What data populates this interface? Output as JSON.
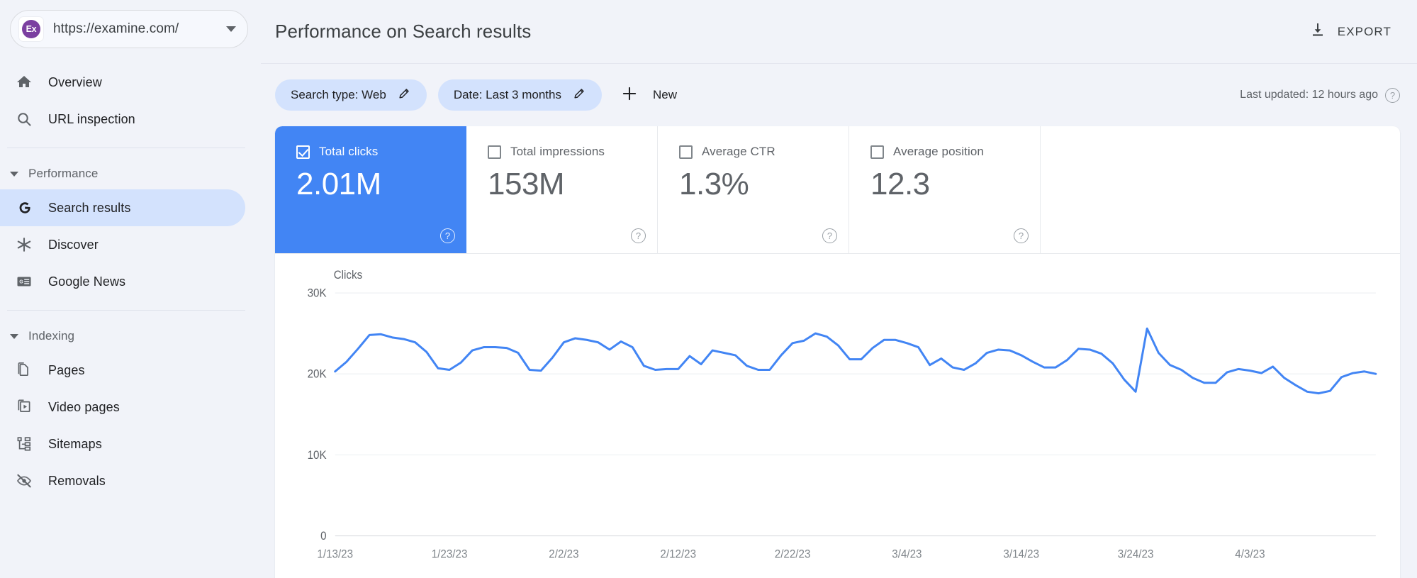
{
  "sidebar": {
    "property": {
      "favicon_text": "Ex",
      "favicon_color": "#7b3fa0",
      "url": "https://examine.com/",
      "dropdown_icon": "chevron-down-icon"
    },
    "top_items": [
      {
        "label": "Overview",
        "icon": "home-icon"
      },
      {
        "label": "URL inspection",
        "icon": "search-icon"
      }
    ],
    "sections": [
      {
        "label": "Performance",
        "expanded": true,
        "items": [
          {
            "label": "Search results",
            "icon": "google-g-icon",
            "active": true
          },
          {
            "label": "Discover",
            "icon": "asterisk-icon",
            "active": false
          },
          {
            "label": "Google News",
            "icon": "news-icon",
            "active": false
          }
        ]
      },
      {
        "label": "Indexing",
        "expanded": true,
        "items": [
          {
            "label": "Pages",
            "icon": "pages-icon",
            "active": false
          },
          {
            "label": "Video pages",
            "icon": "video-pages-icon",
            "active": false
          },
          {
            "label": "Sitemaps",
            "icon": "sitemaps-icon",
            "active": false
          },
          {
            "label": "Removals",
            "icon": "eye-off-icon",
            "active": false
          }
        ]
      }
    ]
  },
  "header": {
    "title": "Performance on Search results",
    "export_label": "EXPORT",
    "export_icon": "download-icon"
  },
  "filters": {
    "chips": [
      {
        "label": "Search type: Web",
        "edit_icon": "pencil-icon"
      },
      {
        "label": "Date: Last 3 months",
        "edit_icon": "pencil-icon"
      }
    ],
    "new_label": "New",
    "new_icon": "plus-icon",
    "last_updated": "Last updated: 12 hours ago",
    "last_updated_icon": "help-icon"
  },
  "metrics": [
    {
      "label": "Total clicks",
      "value": "2.01M",
      "checked": true,
      "help_icon": "help-icon"
    },
    {
      "label": "Total impressions",
      "value": "153M",
      "checked": false,
      "help_icon": "help-icon"
    },
    {
      "label": "Average CTR",
      "value": "1.3%",
      "checked": false,
      "help_icon": "help-icon"
    },
    {
      "label": "Average position",
      "value": "12.3",
      "checked": false,
      "help_icon": "help-icon"
    }
  ],
  "colors": {
    "accent_blue": "#4285f4",
    "chip_blue": "#d3e2fd",
    "line_blue": "#4285f4",
    "page_bg": "#f1f3f9"
  },
  "chart_data": {
    "type": "line",
    "title": "",
    "ylabel": "Clicks",
    "xlabel": "",
    "ylim": [
      0,
      30000
    ],
    "yticks": [
      0,
      10000,
      20000,
      30000
    ],
    "ytick_labels": [
      "0",
      "10K",
      "20K",
      "30K"
    ],
    "grid": true,
    "legend": null,
    "xtick_labels": [
      "1/13/23",
      "1/23/23",
      "2/2/23",
      "2/12/23",
      "2/22/23",
      "3/4/23",
      "3/14/23",
      "3/24/23",
      "4/3/23"
    ],
    "xtick_indices": [
      0,
      10,
      20,
      30,
      40,
      50,
      60,
      70,
      80
    ],
    "series": [
      {
        "name": "Clicks",
        "color": "#4285f4",
        "values": [
          20300,
          21500,
          23100,
          24800,
          24900,
          24500,
          24300,
          23900,
          22700,
          20700,
          20500,
          21400,
          22900,
          23300,
          23300,
          23200,
          22600,
          20500,
          20400,
          22000,
          23900,
          24400,
          24200,
          23900,
          23000,
          24000,
          23300,
          21000,
          20500,
          20600,
          20600,
          22200,
          21200,
          22900,
          22600,
          22300,
          21000,
          20500,
          20500,
          22300,
          23800,
          24100,
          25000,
          24600,
          23500,
          21800,
          21800,
          23200,
          24200,
          24200,
          23800,
          23300,
          21100,
          21900,
          20800,
          20500,
          21300,
          22600,
          23000,
          22900,
          22300,
          21500,
          20800,
          20800,
          21700,
          23100,
          23000,
          22500,
          21300,
          19300,
          17800,
          25600,
          22600,
          21100,
          20500,
          19500,
          18900,
          18900,
          20200,
          20600,
          20400,
          20100,
          20900,
          19500,
          18600,
          17800,
          17600,
          17900,
          19600,
          20100,
          20300,
          20000
        ]
      }
    ]
  }
}
